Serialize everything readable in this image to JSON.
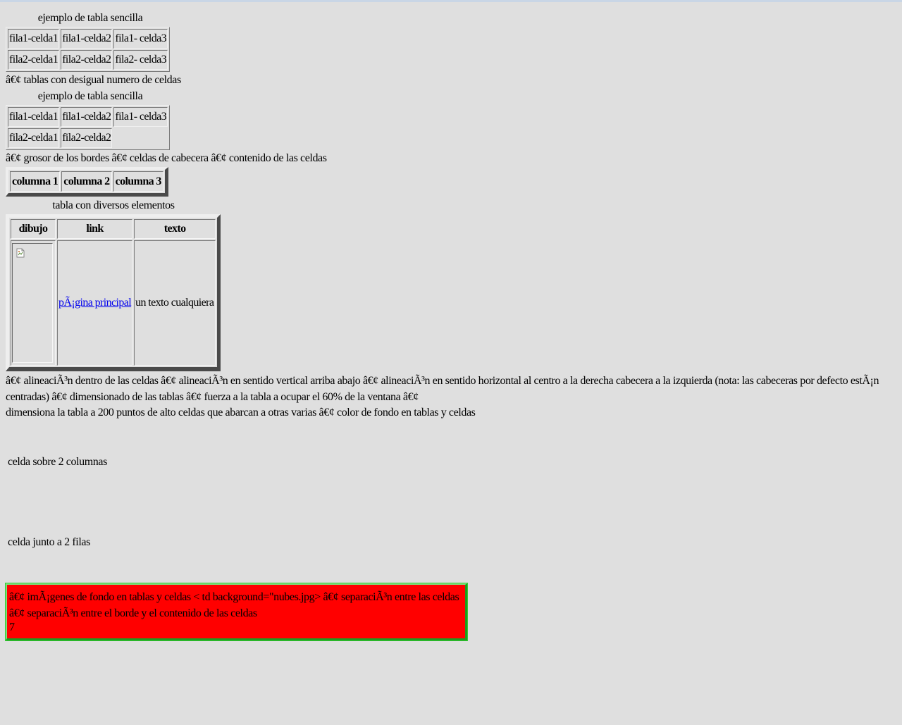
{
  "table1": {
    "caption": "ejemplo de tabla sencilla",
    "rows": [
      [
        "fila1-celda1",
        "fila1-celda2",
        "fila1- celda3"
      ],
      [
        "fila2-celda1",
        "fila2-celda2",
        "fila2- celda3"
      ]
    ]
  },
  "text1": "â€¢ tablas con desigual numero de celdas",
  "table2": {
    "caption": "ejemplo de tabla sencilla",
    "rows": [
      [
        "fila1-celda1",
        "fila1-celda2",
        "fila1- celda3"
      ],
      [
        "fila2-celda1",
        "fila2-celda2"
      ]
    ]
  },
  "text2": "â€¢ grosor de los bordes â€¢ celdas de cabecera â€¢ contenido de las celdas",
  "table3": {
    "headers": [
      "columna 1",
      "columna 2",
      "columna 3"
    ]
  },
  "table4": {
    "caption": "tabla con diversos elementos",
    "headers": [
      "dibujo",
      "link",
      "texto"
    ],
    "image_icon": "broken-image-icon",
    "link_text": "pÃ¡gina principal",
    "text_cell": "un texto cualquiera"
  },
  "text3": "â€¢ alineaciÃ³n dentro de las celdas â€¢ alineaciÃ³n en sentido vertical arriba abajo â€¢ alineaciÃ³n en sentido horizontal al centro a la derecha cabecera a la izquierda (nota: las cabeceras por defecto estÃ¡n centradas) â€¢ dimensionado de las tablas â€¢ fuerza a la tabla a ocupar el 60% de la ventana â€¢",
  "text4": "dimensiona la tabla a 200 puntos de alto celdas que abarcan a otras varias â€¢ color de fondo en tablas y celdas",
  "cell_colspan": "celda sobre 2 columnas",
  "cell_rowspan": "celda junto a 2 filas",
  "redbox": {
    "line1": "â€¢ imÃ¡genes de fondo en tablas y celdas < td background=\"nubes.jpg> â€¢ separaciÃ³n entre las celdas",
    "line2": "â€¢ separaciÃ³n entre el borde y el contenido de las celdas",
    "line3": "7"
  },
  "colors": {
    "page_background": "#dfdfdf",
    "red_box": "#ff0000",
    "green_border": "#33cc33",
    "link": "#0000ee"
  }
}
